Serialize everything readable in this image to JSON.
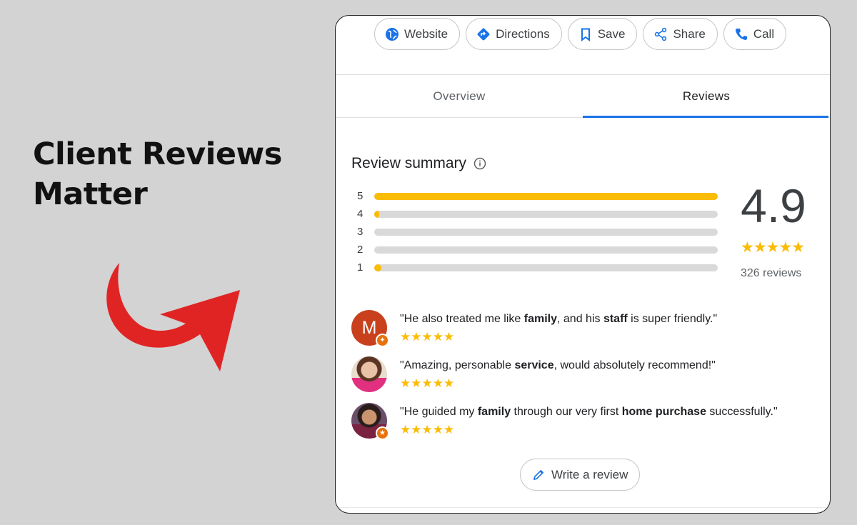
{
  "headline": {
    "line1": "Client Reviews",
    "line2": "Matter"
  },
  "colors": {
    "accent_red": "#e02424",
    "star": "#fbbc04",
    "tab_active": "#1a73e8"
  },
  "actions": [
    {
      "label": "Website",
      "icon": "globe-icon"
    },
    {
      "label": "Directions",
      "icon": "directions-icon"
    },
    {
      "label": "Save",
      "icon": "bookmark-icon"
    },
    {
      "label": "Share",
      "icon": "share-icon"
    },
    {
      "label": "Call",
      "icon": "phone-icon"
    }
  ],
  "tabs": [
    {
      "label": "Overview",
      "active": false
    },
    {
      "label": "Reviews",
      "active": true
    }
  ],
  "summary": {
    "title": "Review summary",
    "rating": "4.9",
    "stars": "★★★★★",
    "count": "326 reviews",
    "distribution": [
      {
        "stars": "5",
        "fraction": 1.0
      },
      {
        "stars": "4",
        "fraction": 0.004
      },
      {
        "stars": "3",
        "fraction": 0
      },
      {
        "stars": "2",
        "fraction": 0
      },
      {
        "stars": "1",
        "fraction": 0.02
      }
    ]
  },
  "reviews": [
    {
      "avatar_letter": "M",
      "stars": "★★★★★",
      "parts": [
        "\"He also treated me like ",
        "family",
        ", and his ",
        "staff",
        " is super friendly.\""
      ]
    },
    {
      "avatar_letter": "",
      "stars": "★★★★★",
      "parts": [
        "\"Amazing, personable ",
        "service",
        ", would absolutely recommend!\""
      ]
    },
    {
      "avatar_letter": "",
      "stars": "★★★★★",
      "parts": [
        "\"He guided my ",
        "family",
        " through our very first ",
        "home purchase",
        " successfully.\""
      ]
    }
  ],
  "write_review": {
    "label": "Write a review",
    "icon": "pencil-icon"
  }
}
